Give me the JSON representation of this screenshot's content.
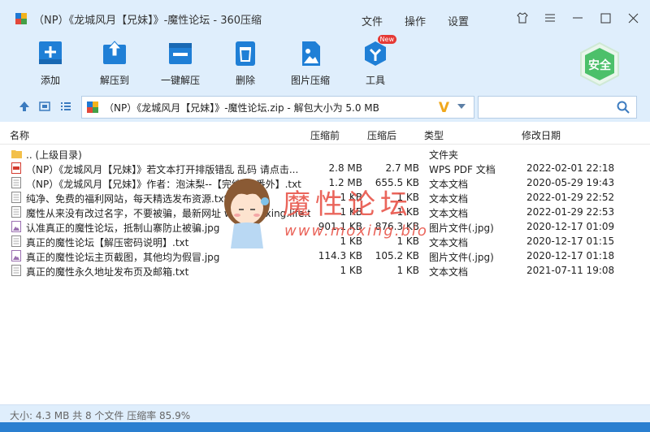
{
  "window": {
    "title": "（NP）《龙城风月【兄妹】》-魔性论坛 - 360压缩",
    "menu": [
      "文件",
      "操作",
      "设置"
    ]
  },
  "toolbar": {
    "items": [
      {
        "label": "添加",
        "icon": "add-icon"
      },
      {
        "label": "解压到",
        "icon": "extract-to-icon"
      },
      {
        "label": "一键解压",
        "icon": "one-click-extract-icon"
      },
      {
        "label": "删除",
        "icon": "delete-icon"
      },
      {
        "label": "图片压缩",
        "icon": "image-compress-icon"
      },
      {
        "label": "工具",
        "icon": "tools-icon",
        "badge": "New"
      }
    ],
    "safe_label": "安全"
  },
  "address": {
    "path": "（NP）《龙城风月【兄妹】》-魔性论坛.zip - 解包大小为 5.0 MB",
    "search_placeholder": ""
  },
  "columns": {
    "name": "名称",
    "size": "压缩前",
    "packed": "压缩后",
    "type": "类型",
    "modified": "修改日期"
  },
  "files": [
    {
      "name": ".. (上级目录)",
      "size": "",
      "packed": "",
      "type": "文件夹",
      "date": "",
      "kind": "folder"
    },
    {
      "name": "（NP）《龙城风月【兄妹】》若文本打开排版错乱 乱码 请点击...",
      "size": "2.8 MB",
      "packed": "2.7 MB",
      "type": "WPS PDF 文档",
      "date": "2022-02-01 22:18",
      "kind": "pdf"
    },
    {
      "name": "（NP）《龙城风月【兄妹】》作者：泡沫梨--【完结+6番外】.txt",
      "size": "1.2 MB",
      "packed": "655.5 KB",
      "type": "文本文档",
      "date": "2020-05-29 19:43",
      "kind": "txt"
    },
    {
      "name": "纯净、免费的福利网站，每天精选发布资源.txt",
      "size": "1 KB",
      "packed": "1 KB",
      "type": "文本文档",
      "date": "2022-01-29 22:52",
      "kind": "txt"
    },
    {
      "name": "魔性从来没有改过名字，不要被骗，最新网址 www.moxing.life.txt",
      "size": "1 KB",
      "packed": "1 KB",
      "type": "文本文档",
      "date": "2022-01-29 22:53",
      "kind": "txt"
    },
    {
      "name": "认准真正的魔性论坛，抵制山寨防止被骗.jpg",
      "size": "901.1 KB",
      "packed": "876.3 KB",
      "type": "图片文件(.jpg)",
      "date": "2020-12-17 01:09",
      "kind": "jpg"
    },
    {
      "name": "真正的魔性论坛【解压密码说明】.txt",
      "size": "1 KB",
      "packed": "1 KB",
      "type": "文本文档",
      "date": "2020-12-17 01:15",
      "kind": "txt"
    },
    {
      "name": "真正的魔性论坛主页截图，其他均为假冒.jpg",
      "size": "114.3 KB",
      "packed": "105.2 KB",
      "type": "图片文件(.jpg)",
      "date": "2020-12-17 01:18",
      "kind": "jpg"
    },
    {
      "name": "真正的魔性永久地址发布页及邮箱.txt",
      "size": "1 KB",
      "packed": "1 KB",
      "type": "文本文档",
      "date": "2021-07-11 19:08",
      "kind": "txt"
    }
  ],
  "watermark": {
    "title": "魔性论坛",
    "url": "www.moxing.bio"
  },
  "status": {
    "text": "大小: 4.3 MB 共 8 个文件 压缩率 85.9%"
  },
  "colors": {
    "chrome": "#dfeefc",
    "accent": "#1e78d4",
    "safe": "#4cc06a"
  }
}
